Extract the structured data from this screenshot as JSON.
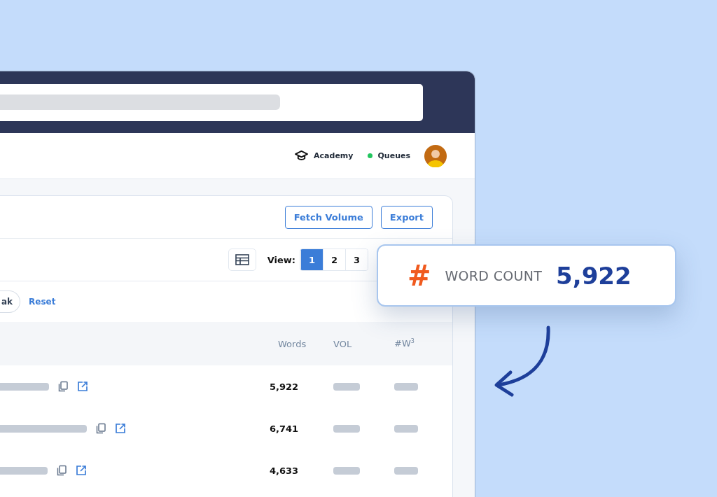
{
  "nav": {
    "links": [
      {
        "kind": "academy",
        "label": "Academy"
      },
      {
        "kind": "status",
        "label": "Queues",
        "color": "#22c55e"
      }
    ]
  },
  "toolbar": {
    "buttons": [
      "Fetch Volume",
      "Export"
    ]
  },
  "view": {
    "label": "View:",
    "options": [
      {
        "label": "1",
        "selected": true
      },
      {
        "label": "2",
        "selected": false
      },
      {
        "label": "3",
        "selected": false
      }
    ]
  },
  "filters": {
    "chip": "ak",
    "reset": "Reset"
  },
  "table": {
    "columns": [
      "Words",
      "VOL",
      "#W$^{3}$"
    ],
    "rows": [
      {
        "words": "5,922"
      },
      {
        "words": "6,741"
      },
      {
        "words": "4,633"
      }
    ]
  },
  "callout": {
    "icon": "#",
    "label": "WORD COUNT",
    "value": "5,922"
  }
}
